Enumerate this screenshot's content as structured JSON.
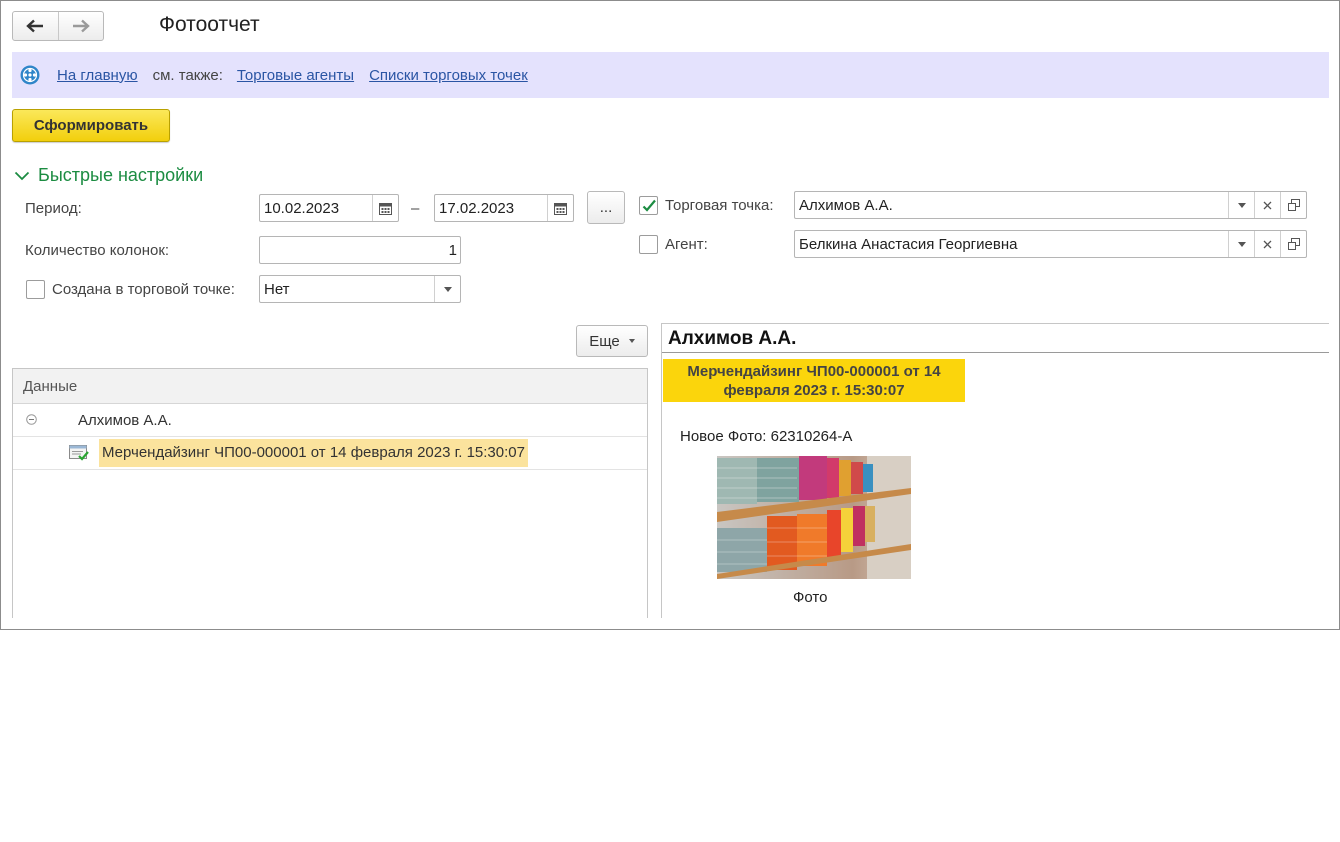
{
  "window": {
    "title": "Фотоотчет"
  },
  "nav": {
    "back_icon": "arrow-left-icon",
    "forward_icon": "arrow-right-icon"
  },
  "linkbar": {
    "home_link": "На главную",
    "see_also": "см. также:",
    "links": [
      "Торговые агенты",
      "Списки торговых точек"
    ]
  },
  "toolbar": {
    "generate_label": "Сформировать"
  },
  "quick_settings": {
    "title": "Быстрые настройки",
    "period_label": "Период:",
    "period_from": "10.02.2023",
    "period_dash": "–",
    "period_to": "17.02.2023",
    "period_select_label": "...",
    "columns_label": "Количество колонок:",
    "columns_value": "1",
    "created_in_store_label": "Создана в торговой точке:",
    "created_in_store_checked": false,
    "created_in_store_value": "Нет",
    "store_label": "Торговая точка:",
    "store_checked": true,
    "store_value": "Алхимов А.А.",
    "agent_label": "Агент:",
    "agent_checked": false,
    "agent_value": "Белкина Анастасия Георгиевна"
  },
  "more_button": {
    "label": "Еще"
  },
  "data_table": {
    "header": "Данные",
    "rows": [
      {
        "text": "Алхимов А.А.",
        "level": 0
      },
      {
        "text": "Мерчендайзинг ЧП00-000001 от 14 февраля 2023 г. 15:30:07",
        "level": 1
      }
    ]
  },
  "report": {
    "title": "Алхимов А.А.",
    "document_line1": "Мерчендайзинг ЧП00-000001 от 14",
    "document_line2": "февраля 2023 г. 15:30:07",
    "new_photo": "Новое Фото: 62310264-А",
    "photo_caption": "Фото"
  },
  "colors": {
    "accent_yellow": "#f2cf0c",
    "group_green": "#1c8c42",
    "link_blue": "#2a55a4",
    "linkbar_bg": "#e4e2fd",
    "highlight": "#fbe39d"
  }
}
